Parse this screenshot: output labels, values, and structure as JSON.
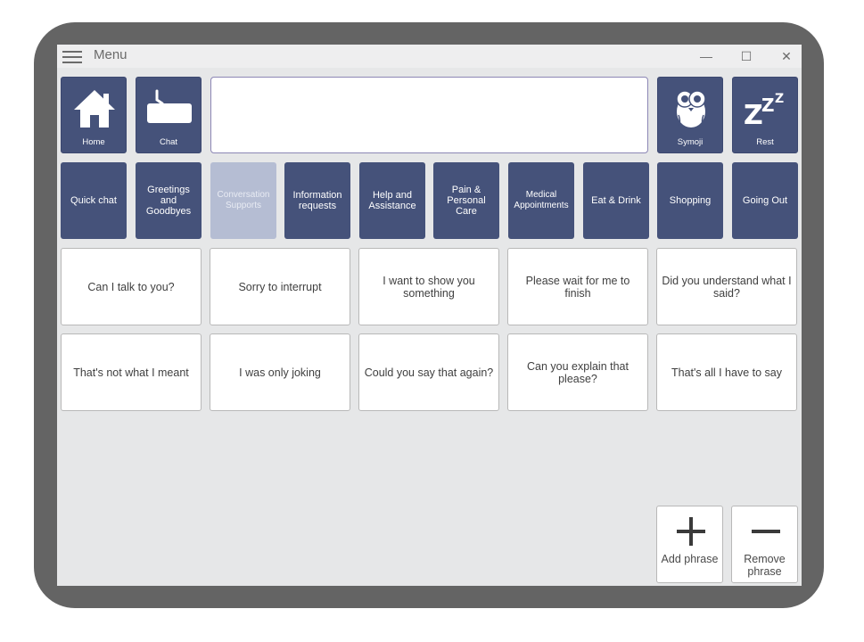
{
  "titlebar": {
    "menu_label": "Menu",
    "minimize": "—",
    "maximize": "☐",
    "close": "✕"
  },
  "nav": {
    "home": "Home",
    "chat": "Chat",
    "symoji": "Symoji",
    "rest": "Rest"
  },
  "message_box": {
    "value": ""
  },
  "categories": [
    "Quick chat",
    "Greetings and Goodbyes",
    "Conversation Supports",
    "Information requests",
    "Help and Assistance",
    "Pain & Personal Care",
    "Medical Appointments",
    "Eat & Drink",
    "Shopping",
    "Going Out"
  ],
  "selected_category": "Conversation Supports",
  "phrases": [
    "Can I talk to you?",
    "Sorry to interrupt",
    "I want to show you something",
    "Please wait for me to finish",
    "Did you understand what I said?",
    "That's not what I meant",
    "I was only joking",
    "Could you say that again?",
    "Can you explain that please?",
    "That's all I have to say"
  ],
  "actions": {
    "add_phrase": "Add phrase",
    "remove_phrase": "Remove phrase"
  },
  "colors": {
    "tile": "#45527a",
    "tile_selected": "#b5bdd3",
    "device_frame": "#646464",
    "screen": "#e6e7e8"
  },
  "icons": [
    "hamburger-icon",
    "home-icon",
    "keyboard-icon",
    "owl-icon",
    "zzz-icon",
    "plus-icon",
    "minus-icon"
  ]
}
